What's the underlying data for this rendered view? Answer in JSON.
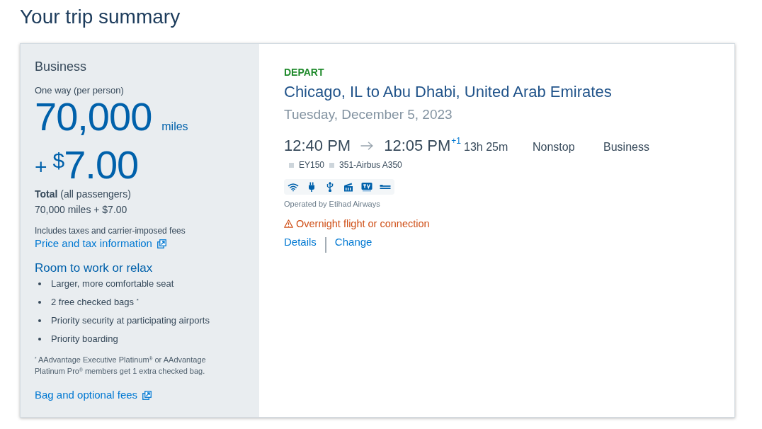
{
  "page_title": "Your trip summary",
  "fare": {
    "cabin": "Business",
    "trip_type": "One way (per person)",
    "miles": "70,000",
    "miles_unit": "miles",
    "cash_sign": "+",
    "cash_currency": "$",
    "cash_amount": "7.00",
    "total_label": "**Total** (all passengers)",
    "total_value": "70,000 miles + $7.00",
    "fees_note": "Includes taxes and carrier-imposed fees",
    "price_link": "Price and tax information"
  },
  "benefits": {
    "heading": "Room to work or relax",
    "items": [
      "Larger, more comfortable seat",
      "2 free checked bags $^{*}$",
      "Priority security at participating airports",
      "Priority boarding"
    ],
    "footnote": "$^{*}$ AAdvantage Executive Platinum$^{®}$ or AAdvantage Platinum Pro$^{®}$ members get 1 extra checked bag.",
    "link": "Bag and optional fees"
  },
  "flight": {
    "direction": "DEPART",
    "route": "Chicago, IL to Abu Dhabi, United Arab Emirates",
    "date": "Tuesday, December 5, 2023",
    "depart_time": "12:40 PM",
    "arrive_time": "12:05 PM",
    "day_offset": "+1",
    "duration": "13h 25m",
    "stops": "Nonstop",
    "cabin": "Business",
    "flight_number": "EY150",
    "aircraft": "351-Airbus A350",
    "operator": "Operated by Etihad Airways",
    "warning": "Overnight flight or connection",
    "links": [
      "Details",
      "Change"
    ]
  }
}
